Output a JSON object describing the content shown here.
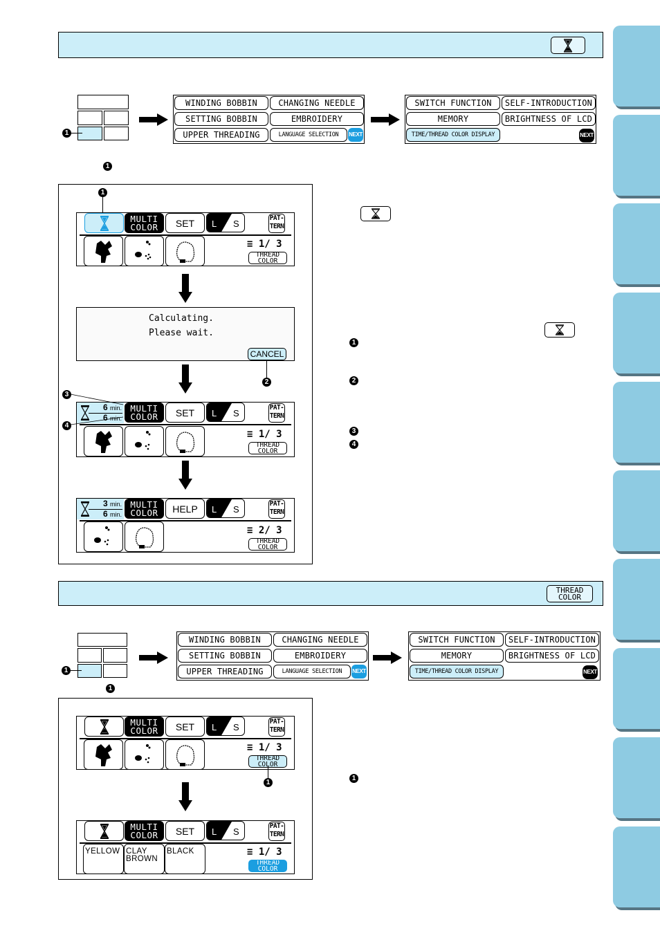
{
  "sections": [
    {
      "id": "time-display",
      "header_icon": "hourglass-icon",
      "menu_page1": {
        "buttons": [
          "WINDING BOBBIN",
          "CHANGING NEEDLE",
          "SETTING BOBBIN",
          "EMBROIDERY",
          "UPPER THREADING",
          "LANGUAGE SELECTION"
        ],
        "next_label": "NEXT"
      },
      "menu_page2": {
        "buttons": [
          "SWITCH FUNCTION",
          "SELF-INTRODUCTION",
          "MEMORY",
          "BRIGHTNESS OF LCD",
          "TIME/THREAD COLOR DISPLAY"
        ],
        "next_label": "NEXT"
      },
      "callout_label": "1"
    },
    {
      "id": "thread-color-display",
      "header_button": {
        "line1": "THREAD",
        "line2": "COLOR"
      },
      "menu_page1": {
        "buttons": [
          "WINDING BOBBIN",
          "CHANGING NEEDLE",
          "SETTING BOBBIN",
          "EMBROIDERY",
          "UPPER THREADING",
          "LANGUAGE SELECTION"
        ],
        "next_label": "NEXT"
      },
      "menu_page2": {
        "buttons": [
          "SWITCH FUNCTION",
          "SELF-INTRODUCTION",
          "MEMORY",
          "BRIGHTNESS OF LCD",
          "TIME/THREAD COLOR DISPLAY"
        ],
        "next_label": "NEXT"
      },
      "callout_label": "1"
    }
  ],
  "lcd": {
    "multi_line1": "MULTI",
    "multi_line2": "COLOR",
    "set_label": "SET",
    "help_label": "HELP",
    "l_label": "L",
    "s_label": "S",
    "pattern_line1": "PAT-",
    "pattern_line2": "TERN",
    "thread_line1": "THREAD",
    "thread_line2": "COLOR",
    "counter_1_3": "1/ 3",
    "counter_2_3": "2/ 3"
  },
  "screens": {
    "s1": {
      "counter": "1/ 3"
    },
    "calculating": {
      "line1": "Calculating.",
      "line2": "Please wait.",
      "cancel": "CANCEL"
    },
    "s3": {
      "time_remaining": "6",
      "time_total": "6",
      "unit": "min.",
      "counter": "1/ 3"
    },
    "s4": {
      "time_remaining": "3",
      "time_total": "6",
      "unit": "min.",
      "counter": "2/ 3"
    },
    "s5": {
      "counter": "1/ 3"
    },
    "s6": {
      "colors": [
        "YELLOW",
        "CLAY\nBROWN",
        "BLACK"
      ],
      "counter": "1/ 3"
    }
  },
  "callouts": [
    "1",
    "2",
    "3",
    "4"
  ],
  "colors": {
    "section_bg": "#cceef9",
    "tab_bg": "#8ecbe2",
    "tab_shadow": "#567583",
    "next_blue": "#1b9ee0",
    "thread_active": "#1b9ee0"
  },
  "side_tabs_count": 10
}
